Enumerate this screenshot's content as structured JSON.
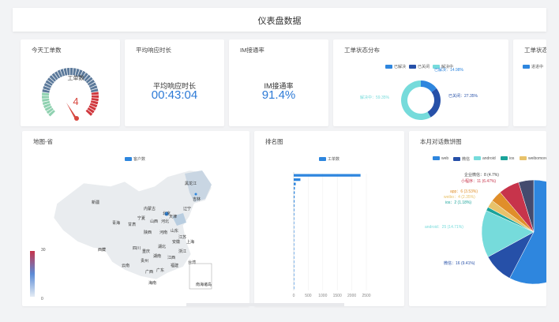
{
  "header": {
    "title": "仪表盘数据"
  },
  "cards": {
    "ticket_today": {
      "title": "今天工单数",
      "gauge_label": "工单数",
      "gauge_value": "4"
    },
    "avg_response": {
      "title": "平均响应时长",
      "label": "平均响应时长",
      "value": "00:43:04"
    },
    "im_rate": {
      "title": "IM接通率",
      "label": "IM接通率",
      "value": "91.4%"
    },
    "ticket_status": {
      "title": "工单状态分布",
      "legend": [
        "已解决",
        "已关闭",
        "解决中"
      ],
      "labels": [
        "已解决：14.98%",
        "已关闭：27.35%",
        "解决中：59.35%"
      ],
      "colors": [
        "#2e86de",
        "#2650a8",
        "#76dbdb"
      ]
    },
    "ticket_status2": {
      "title": "工单状态",
      "legend": [
        "进进中"
      ]
    },
    "map": {
      "title": "地图-省",
      "legend": "客户数",
      "vmax": "30",
      "vmin": "0",
      "provinces": [
        "新疆",
        "西藏",
        "青海",
        "甘肃",
        "宁夏",
        "内蒙古",
        "黑龙江",
        "吉林",
        "辽宁",
        "北京",
        "天津",
        "河北",
        "山西",
        "陕西",
        "山东",
        "河南",
        "四川",
        "重庆",
        "湖北",
        "安徽",
        "江苏",
        "上海",
        "浙江",
        "湖南",
        "江西",
        "贵州",
        "云南",
        "福建",
        "广西",
        "广东",
        "台湾",
        "海南",
        "南海诸岛"
      ]
    },
    "ranking": {
      "title": "排名图",
      "legend": "工单数",
      "x_ticks": [
        "0",
        "500",
        "1000",
        "1500",
        "2000",
        "2500"
      ]
    },
    "dialogs": {
      "title": "本月对话数饼图",
      "legend": [
        "web",
        "微信",
        "android",
        "ios",
        "weibo",
        "more"
      ],
      "labels": [
        "企业微信：8 (4.7%)",
        "小程序：11 (6.47%)",
        "app：6 (3.53%)",
        "weibo：4 (2.35%)",
        "ios：2 (1.18%)",
        "android：25 (14.71%)",
        "微信：16 (9.41%)"
      ]
    }
  },
  "chart_data": [
    {
      "type": "pie",
      "title": "工单状态分布",
      "categories": [
        "已解决",
        "已关闭",
        "解决中"
      ],
      "values": [
        14.98,
        27.35,
        59.35
      ]
    },
    {
      "type": "bar",
      "title": "排名图",
      "series": [
        {
          "name": "工单数",
          "values": [
            2300,
            230,
            70,
            40,
            35,
            30,
            28,
            25,
            22,
            20,
            18,
            16,
            15,
            13,
            12,
            11,
            10,
            9,
            8,
            8,
            7,
            6,
            6,
            5,
            5,
            4,
            4
          ]
        }
      ],
      "xlim": [
        0,
        2500
      ]
    },
    {
      "type": "pie",
      "title": "本月对话数饼图",
      "categories": [
        "web",
        "微信",
        "android",
        "ios",
        "weibo",
        "app",
        "小程序",
        "企业微信",
        "more"
      ],
      "values": [
        98,
        16,
        25,
        2,
        4,
        6,
        11,
        8,
        0
      ],
      "unit_note": ""
    }
  ]
}
